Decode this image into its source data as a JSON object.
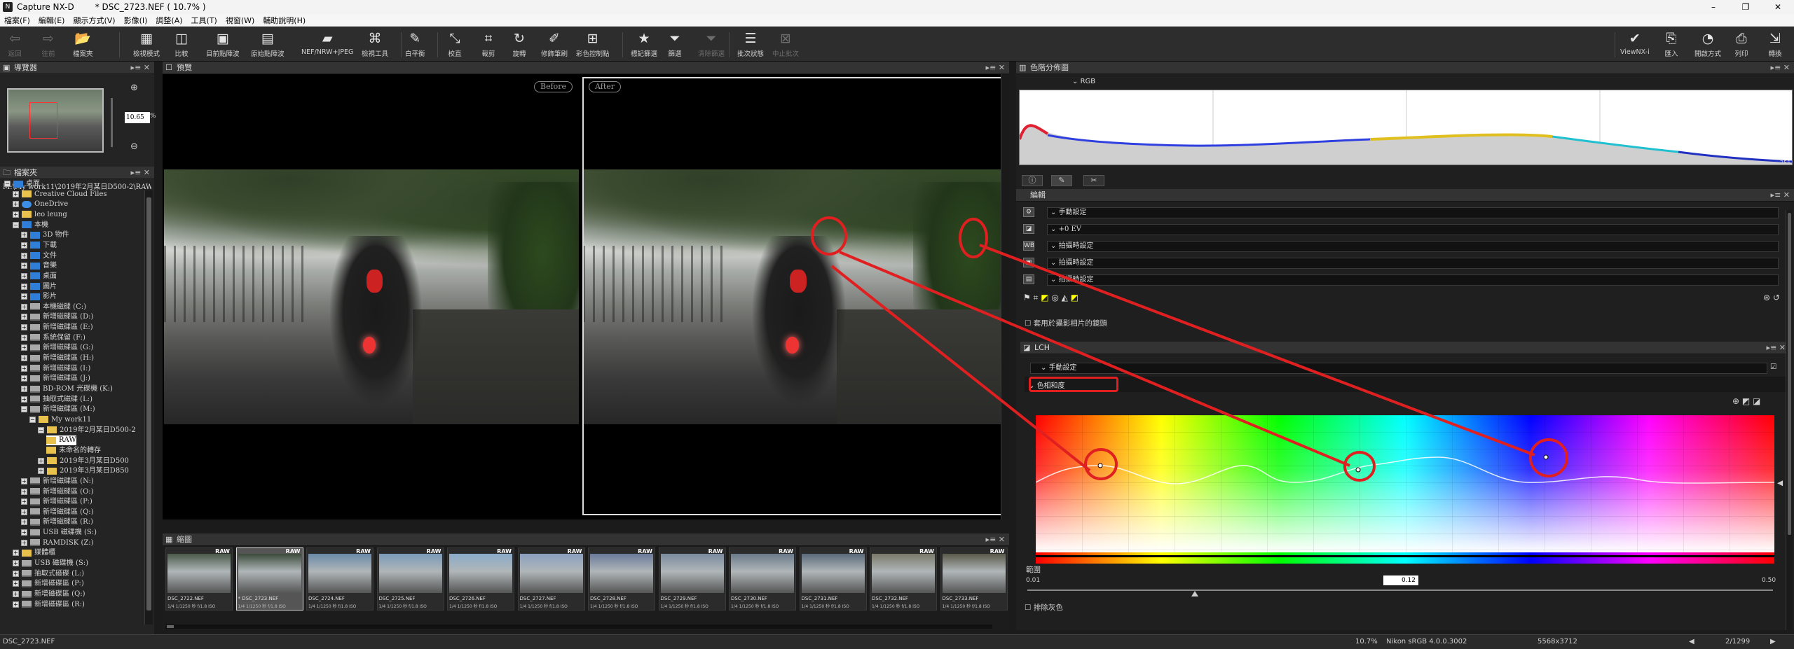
{
  "window": {
    "title": "Capture NX-D",
    "doc": "* DSC_2723.NEF ( 10.7% )",
    "min": "–",
    "max": "❐",
    "close": "✕"
  },
  "menu": [
    "檔案(F)",
    "編輯(E)",
    "顯示方式(V)",
    "影像(I)",
    "調整(A)",
    "工具(T)",
    "視窗(W)",
    "輔助說明(H)"
  ],
  "toolbar": {
    "left": [
      {
        "label": "返回",
        "icon": "⇦",
        "dis": true
      },
      {
        "label": "往前",
        "icon": "⇨",
        "dis": true
      },
      {
        "label": "檔案夾",
        "icon": "📂",
        "dis": false
      }
    ],
    "mid": [
      {
        "label": "檢視模式",
        "icon": "▦"
      },
      {
        "label": "比較",
        "icon": "◫"
      },
      {
        "label": "目前點陣波",
        "icon": "▣"
      },
      {
        "label": "原始點陣波",
        "icon": "▤"
      },
      {
        "label": "NEF/NRW+JPEG",
        "icon": "▰"
      },
      {
        "label": "檢視工具",
        "icon": "⌘"
      },
      {
        "label": "白平衡",
        "icon": "✎"
      },
      {
        "label": "校直",
        "icon": "⤡"
      },
      {
        "label": "裁剪",
        "icon": "⌗"
      },
      {
        "label": "旋轉",
        "icon": "↻"
      },
      {
        "label": "修飾筆刷",
        "icon": "✐"
      },
      {
        "label": "彩色控制點",
        "icon": "⊞"
      },
      {
        "label": "標記篩選",
        "icon": "★"
      },
      {
        "label": "篩選",
        "icon": "⏷"
      },
      {
        "label": "清除篩選",
        "icon": "⏷",
        "dis": true
      },
      {
        "label": "批次狀態",
        "icon": "☰"
      },
      {
        "label": "中止批次",
        "icon": "⊠",
        "dis": true
      }
    ],
    "right": [
      {
        "label": "ViewNX-i",
        "icon": "✔"
      },
      {
        "label": "匯入",
        "icon": "⎘"
      },
      {
        "label": "開啟方式",
        "icon": "◔"
      },
      {
        "label": "列印",
        "icon": "⎙"
      },
      {
        "label": "轉換",
        "icon": "⇲"
      }
    ]
  },
  "navigator": {
    "title": "導覽器",
    "zoom": "10.65",
    "unit": "%"
  },
  "folder": {
    "title": "檔案夾",
    "path": "M:\\My work11\\2019年2月某日D500-2\\RAW",
    "items": [
      {
        "label": "桌面",
        "indent": 0,
        "ex": "−",
        "icon": "blue"
      },
      {
        "label": "Creative Cloud Files",
        "indent": 1,
        "ex": "+",
        "icon": "folder"
      },
      {
        "label": "OneDrive",
        "indent": 1,
        "ex": "+",
        "icon": "cloud"
      },
      {
        "label": "leo leung",
        "indent": 1,
        "ex": "+",
        "icon": "folder"
      },
      {
        "label": "本機",
        "indent": 1,
        "ex": "−",
        "icon": "blue"
      },
      {
        "label": "3D 物件",
        "indent": 2,
        "ex": "+",
        "icon": "blue"
      },
      {
        "label": "下載",
        "indent": 2,
        "ex": "+",
        "icon": "blue"
      },
      {
        "label": "文件",
        "indent": 2,
        "ex": "+",
        "icon": "blue"
      },
      {
        "label": "音樂",
        "indent": 2,
        "ex": "+",
        "icon": "blue"
      },
      {
        "label": "桌面",
        "indent": 2,
        "ex": "+",
        "icon": "blue"
      },
      {
        "label": "圖片",
        "indent": 2,
        "ex": "+",
        "icon": "blue"
      },
      {
        "label": "影片",
        "indent": 2,
        "ex": "+",
        "icon": "blue"
      },
      {
        "label": "本機磁碟 (C:)",
        "indent": 2,
        "ex": "+",
        "icon": "drive"
      },
      {
        "label": "新增磁碟區 (D:)",
        "indent": 2,
        "ex": "+",
        "icon": "drive"
      },
      {
        "label": "新增磁碟區 (E:)",
        "indent": 2,
        "ex": "+",
        "icon": "drive"
      },
      {
        "label": "系統保留 (F:)",
        "indent": 2,
        "ex": "+",
        "icon": "drive"
      },
      {
        "label": "新增磁碟區 (G:)",
        "indent": 2,
        "ex": "+",
        "icon": "drive"
      },
      {
        "label": "新增磁碟區 (H:)",
        "indent": 2,
        "ex": "+",
        "icon": "drive"
      },
      {
        "label": "新增磁碟區 (I:)",
        "indent": 2,
        "ex": "+",
        "icon": "drive"
      },
      {
        "label": "新增磁碟區 (J:)",
        "indent": 2,
        "ex": "+",
        "icon": "drive"
      },
      {
        "label": "BD-ROM 光碟機 (K:)",
        "indent": 2,
        "ex": "+",
        "icon": "drive"
      },
      {
        "label": "抽取式磁碟 (L:)",
        "indent": 2,
        "ex": "+",
        "icon": "drive"
      },
      {
        "label": "新增磁碟區 (M:)",
        "indent": 2,
        "ex": "−",
        "icon": "drive"
      },
      {
        "label": "My work11",
        "indent": 3,
        "ex": "−",
        "icon": "folder"
      },
      {
        "label": "2019年2月某日D500-2",
        "indent": 4,
        "ex": "−",
        "icon": "folder"
      },
      {
        "label": "RAW",
        "indent": 5,
        "ex": "",
        "icon": "folder",
        "sel": true
      },
      {
        "label": "未命名的轉存",
        "indent": 5,
        "ex": "",
        "icon": "folder"
      },
      {
        "label": "2019年3月某日D500",
        "indent": 4,
        "ex": "+",
        "icon": "folder"
      },
      {
        "label": "2019年3月某日D850",
        "indent": 4,
        "ex": "+",
        "icon": "folder"
      },
      {
        "label": "新增磁碟區 (N:)",
        "indent": 2,
        "ex": "+",
        "icon": "drive"
      },
      {
        "label": "新增磁碟區 (O:)",
        "indent": 2,
        "ex": "+",
        "icon": "drive"
      },
      {
        "label": "新增磁碟區 (P:)",
        "indent": 2,
        "ex": "+",
        "icon": "drive"
      },
      {
        "label": "新增磁碟區 (Q:)",
        "indent": 2,
        "ex": "+",
        "icon": "drive"
      },
      {
        "label": "新增磁碟區 (R:)",
        "indent": 2,
        "ex": "+",
        "icon": "drive"
      },
      {
        "label": "USB 磁碟機 (S:)",
        "indent": 2,
        "ex": "+",
        "icon": "drive"
      },
      {
        "label": "RAMDISK (Z:)",
        "indent": 2,
        "ex": "+",
        "icon": "drive"
      },
      {
        "label": "媒體櫃",
        "indent": 1,
        "ex": "+",
        "icon": "folder"
      },
      {
        "label": "USB 磁碟機 (S:)",
        "indent": 1,
        "ex": "+",
        "icon": "drive"
      },
      {
        "label": "抽取式磁碟 (L:)",
        "indent": 1,
        "ex": "+",
        "icon": "drive"
      },
      {
        "label": "新增磁碟區 (P:)",
        "indent": 1,
        "ex": "+",
        "icon": "drive"
      },
      {
        "label": "新增磁碟區 (Q:)",
        "indent": 1,
        "ex": "+",
        "icon": "drive"
      },
      {
        "label": "新增磁碟區 (R:)",
        "indent": 1,
        "ex": "+",
        "icon": "drive"
      }
    ]
  },
  "preview": {
    "title": "預覽",
    "before": "Before",
    "after": "After"
  },
  "thumbs": {
    "title": "縮圖",
    "items": [
      {
        "name": "DSC_2722.NEF",
        "meta": "1/4 1/1250 秒 f/1.8 ISO"
      },
      {
        "name": "* DSC_2723.NEF",
        "meta": "1/4 1/1250 秒 f/1.8 ISO"
      },
      {
        "name": "DSC_2724.NEF",
        "meta": "1/4 1/1250 秒 f/1.8 ISO"
      },
      {
        "name": "DSC_2725.NEF",
        "meta": "1/4 1/1250 秒 f/1.8 ISO"
      },
      {
        "name": "DSC_2726.NEF",
        "meta": "1/4 1/1250 秒 f/1.8 ISO"
      },
      {
        "name": "DSC_2727.NEF",
        "meta": "1/4 1/1250 秒 f/1.8 ISO"
      },
      {
        "name": "DSC_2728.NEF",
        "meta": "1/4 1/1250 秒 f/1.8 ISO"
      },
      {
        "name": "DSC_2729.NEF",
        "meta": "1/4 1/1250 秒 f/1.8 ISO"
      },
      {
        "name": "DSC_2730.NEF",
        "meta": "1/4 1/1250 秒 f/1.8 ISO"
      },
      {
        "name": "DSC_2731.NEF",
        "meta": "1/4 1/1250 秒 f/1.8 ISO"
      },
      {
        "name": "DSC_2732.NEF",
        "meta": "1/4 1/1250 秒 f/1.8 ISO"
      },
      {
        "name": "DSC_2733.NEF",
        "meta": "1/4 1/1250 秒 f/1.8 ISO"
      }
    ],
    "raw": "RAW"
  },
  "histogram": {
    "title": "色階分佈圖",
    "channel": "RGB",
    "min": "0",
    "max": "255"
  },
  "edit": {
    "title": "編輯",
    "rows": [
      {
        "icon": "⚙",
        "label": "手動設定"
      },
      {
        "icon": "◪",
        "label": "+0 EV"
      },
      {
        "icon": "WB",
        "label": "拍攝時設定"
      },
      {
        "icon": "▣",
        "label": "拍攝時設定"
      },
      {
        "icon": "▤",
        "label": "拍攝時設定"
      }
    ],
    "partial": "套用於攝影相片的鏡頭"
  },
  "lch": {
    "title": "LCH",
    "preset": "手動設定",
    "channel": "色相和度",
    "range_label": "範圍",
    "range_min": "0.01",
    "range_max": "0.50",
    "range_value": "0.12",
    "keep_gray": "排除灰色"
  },
  "status": {
    "file": "DSC_2723.NEF",
    "zoom": "10.7%",
    "profile": "Nikon sRGB 4.0.0.3002",
    "size": "5568x3712",
    "count": "2/1299"
  }
}
